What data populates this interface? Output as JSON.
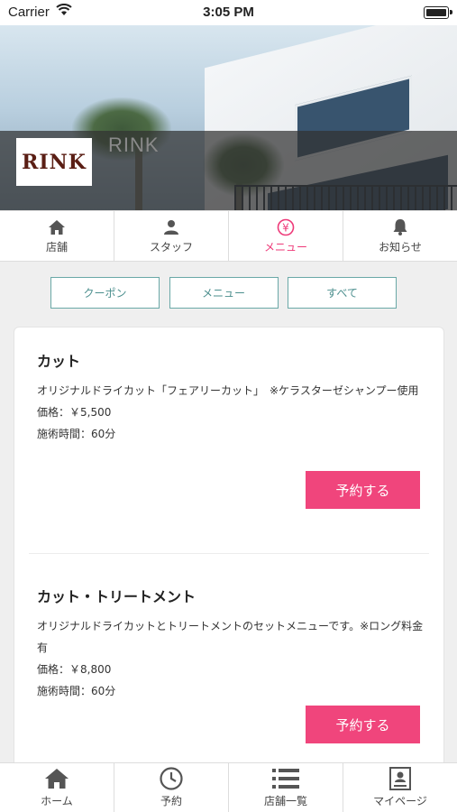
{
  "status": {
    "carrier": "Carrier",
    "time": "3:05 PM"
  },
  "hero": {
    "logo_text": "RINK",
    "shop_name": "RINK"
  },
  "tabs": [
    {
      "label": "店舗",
      "icon": "home-icon"
    },
    {
      "label": "スタッフ",
      "icon": "person-icon"
    },
    {
      "label": "メニュー",
      "icon": "yen-icon",
      "active": true
    },
    {
      "label": "お知らせ",
      "icon": "bell-icon"
    }
  ],
  "filters": [
    "クーポン",
    "メニュー",
    "すべて"
  ],
  "menu": [
    {
      "title": "カット",
      "desc": "オリジナルドライカット「フェアリーカット」　※ケラスターゼシャンプー使用",
      "price": "価格：￥5,500",
      "time": "施術時間：60分",
      "button": "予約する"
    },
    {
      "title": "カット・トリートメント",
      "desc": "オリジナルドライカットとトリートメントのセットメニューです。※ロング料金有",
      "price": "価格：￥8,800",
      "time": "施術時間：60分",
      "button": "予約する"
    }
  ],
  "bottom_nav": [
    {
      "label": "ホーム",
      "icon": "home-icon"
    },
    {
      "label": "予約",
      "icon": "clock-icon"
    },
    {
      "label": "店舗一覧",
      "icon": "list-icon"
    },
    {
      "label": "マイページ",
      "icon": "profile-card-icon"
    }
  ],
  "colors": {
    "accent": "#ee3a79",
    "book_button": "#f0457c",
    "filter_border": "#6aa8a7"
  }
}
